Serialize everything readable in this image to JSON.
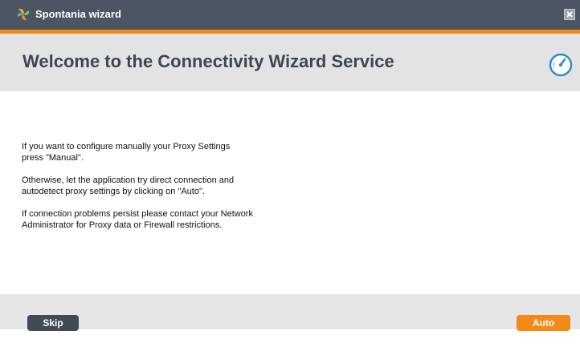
{
  "window": {
    "title": "Spontania wizard",
    "icon": "spontania-logo-icon",
    "close_icon": "close-icon"
  },
  "colors": {
    "titlebar": "#4b5563",
    "accent": "#f28a1a",
    "header_bg": "#e3e3e3",
    "footer_bg": "#e6e6e6",
    "skip_button": "#424a57",
    "auto_button": "#f28a1a"
  },
  "header": {
    "title": "Welcome to the Connectivity Wizard Service",
    "icon": "gauge-icon"
  },
  "body": {
    "paragraphs": [
      {
        "line1": "If you want to configure manually your Proxy Settings",
        "line2": "press \"Manual\"."
      },
      {
        "line1": "Otherwise, let the application try direct connection and",
        "line2": "autodetect proxy settings by clicking on \"Auto\"."
      },
      {
        "line1": "If connection problems persist please contact your Network",
        "line2": "Administrator for Proxy data or Firewall restrictions."
      }
    ]
  },
  "footer": {
    "skip_label": "Skip",
    "auto_label": "Auto"
  }
}
